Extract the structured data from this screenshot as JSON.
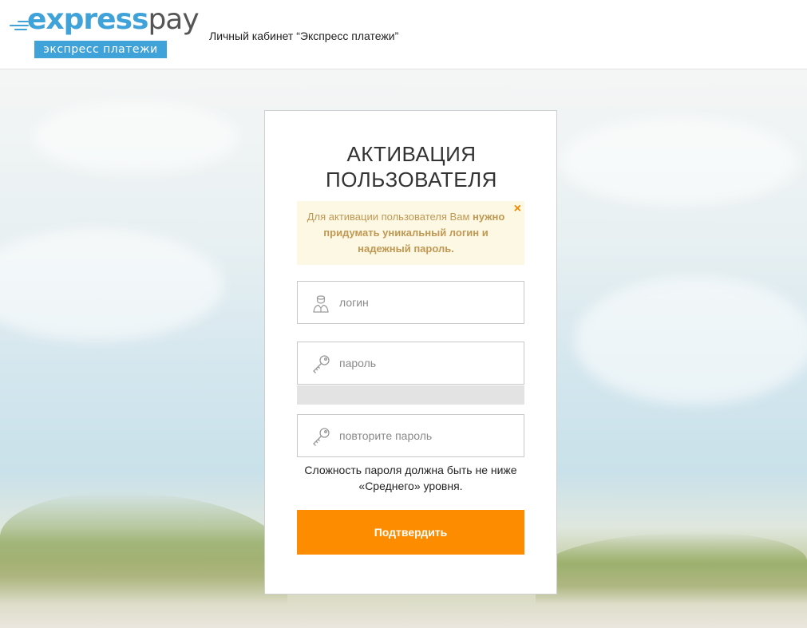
{
  "header": {
    "logo": {
      "word_express": "express",
      "word_pay": "pay",
      "subtitle": "экспресс платежи"
    },
    "title": "Личный кабинет “Экспресс платежи”"
  },
  "form": {
    "title": "АКТИВАЦИЯ ПОЛЬЗОВАТЕЛЯ",
    "alert": {
      "text_plain": "Для активации пользователя Вам",
      "text_bold": "нужно придумать уникальный логин и надежный пароль.",
      "close_icon": "×"
    },
    "login": {
      "placeholder": "логин",
      "value": "",
      "icon": "user-icon"
    },
    "password": {
      "placeholder": "пароль",
      "value": "",
      "icon": "key-icon"
    },
    "password_strength": {
      "level": 0
    },
    "repeat_password": {
      "placeholder": "повторите пароль",
      "value": "",
      "icon": "key-icon"
    },
    "hint": "Сложность пароля должна быть не ниже «Среднего» уровня.",
    "submit_label": "Подтвердить"
  },
  "colors": {
    "brand_blue": "#3fa2d9",
    "accent_orange": "#fd8c00",
    "alert_bg": "#fcf8e3",
    "alert_text": "#c09853"
  }
}
